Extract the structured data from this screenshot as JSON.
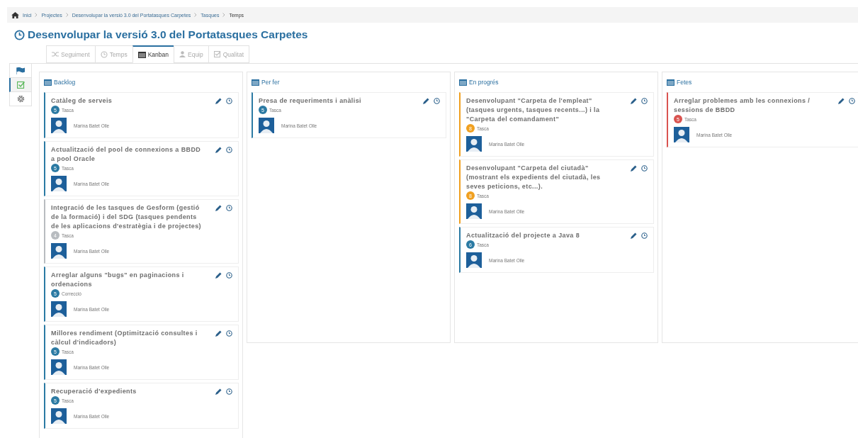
{
  "breadcrumb": [
    {
      "label": "Inici",
      "kind": "home",
      "current": false
    },
    {
      "label": "Projectes",
      "kind": "link",
      "current": false
    },
    {
      "label": "Desenvolupar la versió 3.0 del Portatasques Carpetes",
      "kind": "link",
      "current": false
    },
    {
      "label": "Tasques",
      "kind": "link",
      "current": false
    },
    {
      "label": "Temps",
      "kind": "link",
      "current": true
    }
  ],
  "title": "Desenvolupar la versió 3.0 del Portatasques Carpetes",
  "tabs": [
    {
      "label": "Seguiment",
      "selected": false
    },
    {
      "label": "Temps",
      "selected": false
    },
    {
      "label": "Kanban",
      "selected": true
    },
    {
      "label": "Equip",
      "selected": false
    },
    {
      "label": "Qualitat",
      "selected": false
    }
  ],
  "side_tools": [
    {
      "selected": false
    },
    {
      "selected": true
    },
    {
      "selected": false
    }
  ],
  "columns": [
    {
      "name": "Backlog",
      "cards": [
        {
          "title": "Catàleg de serveis",
          "badge": "5",
          "type": "Tasca",
          "color": "#2b7aa3",
          "assignee": "Marina Batet Olle"
        },
        {
          "title": "Actualització del pool de connexions a BBDD a pool Oracle",
          "badge": "5",
          "type": "Tasca",
          "color": "#2b7aa3",
          "assignee": "Marina Batet Olle"
        },
        {
          "title": "Integració de les tasques de Gesform (gestió de la formació) i del SDG (tasques pendents de les aplicacions d'estratègia i de projectes)",
          "badge": "4",
          "type": "Tasca",
          "color": "#b8bcc0",
          "assignee": "Marina Batet Olle"
        },
        {
          "title": "Arreglar alguns \"bugs\" en paginacions i ordenacions",
          "badge": "5",
          "type": "Correcció",
          "color": "#2b7aa3",
          "assignee": "Marina Batet Olle"
        },
        {
          "title": "Millores rendiment (Optimització consultes i càlcul d'indicadors)",
          "badge": "5",
          "type": "Tasca",
          "color": "#2b7aa3",
          "assignee": "Marina Batet Olle"
        },
        {
          "title": "Recuperació d'expedients",
          "badge": "5",
          "type": "Tasca",
          "color": "#2b7aa3",
          "assignee": "Marina Batet Olle"
        }
      ]
    },
    {
      "name": "Per fer",
      "cards": [
        {
          "title": "Presa de requeriments i anàlisi",
          "badge": "5",
          "type": "Tasca",
          "color": "#2b7aa3",
          "assignee": "Marina Batet Olle"
        }
      ]
    },
    {
      "name": "En progrés",
      "cards": [
        {
          "title": "Desenvolupant \"Carpeta de l'empleat\" (tasques urgents, tasques recents...) i la \"Carpeta del comandament\"",
          "badge": "8",
          "type": "Tasca",
          "color": "#f0a020",
          "assignee": "Marina Batet Olle"
        },
        {
          "title": "Desenvolupant \"Carpeta del ciutadà\" (mostrant els expedients del ciutadà, les seves peticions, etc...).",
          "badge": "8",
          "type": "Tasca",
          "color": "#f0a020",
          "assignee": "Marina Batet Olle"
        },
        {
          "title": "Actualització del projecte a Java 8",
          "badge": "6",
          "type": "Tasca",
          "color": "#2b7aa3",
          "assignee": "Marina Batet Olle"
        }
      ]
    },
    {
      "name": "Fetes",
      "cards": [
        {
          "title": "Arreglar problemes amb les connexions / sessions de BBDD",
          "badge": "5",
          "type": "Tasca",
          "color": "#d9534f",
          "assignee": "Marina Batet Olle"
        }
      ]
    }
  ]
}
